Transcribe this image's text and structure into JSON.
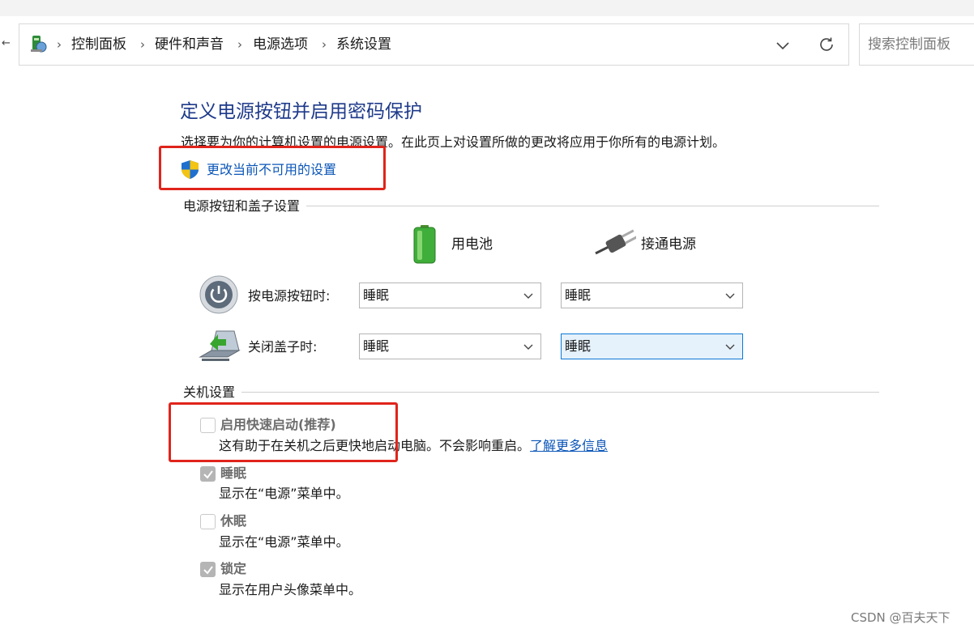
{
  "address_bar": {
    "back_glyph": "←",
    "breadcrumbs": [
      "控制面板",
      "硬件和声音",
      "电源选项",
      "系统设置"
    ],
    "separator": "›",
    "search_placeholder": "搜索控制面板"
  },
  "page": {
    "title": "定义电源按钮并启用密码保护",
    "description": "选择要为你的计算机设置的电源设置。在此页上对设置所做的更改将应用于你所有的电源计划。",
    "change_link": "更改当前不可用的设置"
  },
  "power_section": {
    "heading": "电源按钮和盖子设置",
    "columns": {
      "battery": "用电池",
      "plugged": "接通电源"
    },
    "rows": [
      {
        "label": "按电源按钮时:",
        "battery_value": "睡眠",
        "plugged_value": "睡眠"
      },
      {
        "label": "关闭盖子时:",
        "battery_value": "睡眠",
        "plugged_value": "睡眠"
      }
    ]
  },
  "shutdown_section": {
    "heading": "关机设置",
    "options": [
      {
        "title": "启用快速启动(推荐)",
        "desc": "这有助于在关机之后更快地启动电脑。不会影响重启。",
        "link": "了解更多信息",
        "checked": false
      },
      {
        "title": "睡眠",
        "desc": "显示在“电源”菜单中。",
        "checked": true
      },
      {
        "title": "休眠",
        "desc": "显示在“电源”菜单中。",
        "checked": false
      },
      {
        "title": "锁定",
        "desc": "显示在用户头像菜单中。",
        "checked": true
      }
    ]
  },
  "watermark": "CSDN @百夫天下",
  "icons": {
    "address": "control-panel-icon",
    "dropdown": "chevron-down-icon",
    "refresh": "refresh-icon",
    "shield": "uac-shield-icon",
    "battery": "battery-icon",
    "plug": "power-plug-icon",
    "power_button": "power-button-icon",
    "lid": "laptop-lid-icon",
    "check": "checkmark-icon"
  },
  "colors": {
    "title": "#1e3a8a",
    "link": "#0b56b8",
    "highlight_box": "#e0241b",
    "focused_select": "#e5f1fb"
  }
}
